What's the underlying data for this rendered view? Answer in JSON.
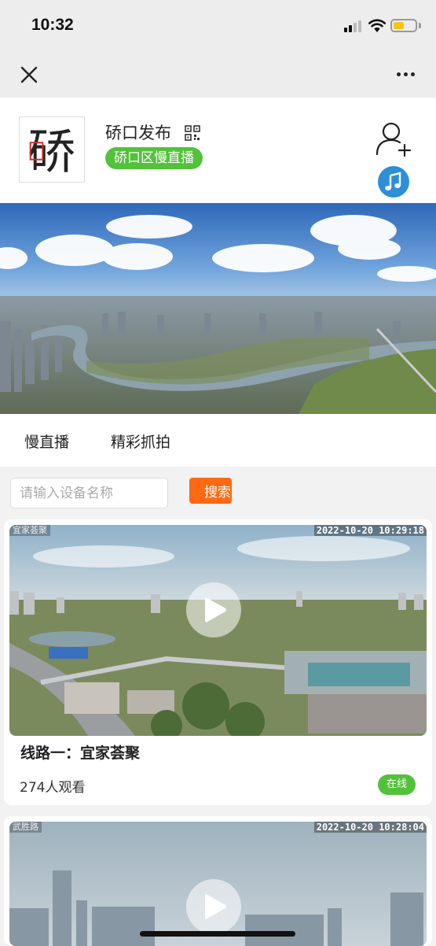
{
  "status_bar": {
    "time": "10:32"
  },
  "profile": {
    "account_name": "硚口发布",
    "live_badge": "硚口区慢直播",
    "logo_text": "硚"
  },
  "tabs": [
    {
      "label": "慢直播"
    },
    {
      "label": "精彩抓拍"
    }
  ],
  "search": {
    "placeholder": "请输入设备名称",
    "button_label": "搜索"
  },
  "streams": [
    {
      "thumb_tag": "宜家荟聚",
      "timestamp": "2022-10-20 10:29:18",
      "title": "线路一：宜家荟聚",
      "views": "274人观看",
      "status": "在线"
    },
    {
      "thumb_tag": "武胜路",
      "timestamp": "2022-10-20 10:28:04"
    }
  ],
  "colors": {
    "accent_green": "#52c23a",
    "search_orange": "#fe6a13",
    "music_blue": "#2d8fd8"
  },
  "icons": [
    "close-icon",
    "more-icon",
    "qr-code-icon",
    "add-user-icon",
    "music-note-icon",
    "play-icon"
  ]
}
